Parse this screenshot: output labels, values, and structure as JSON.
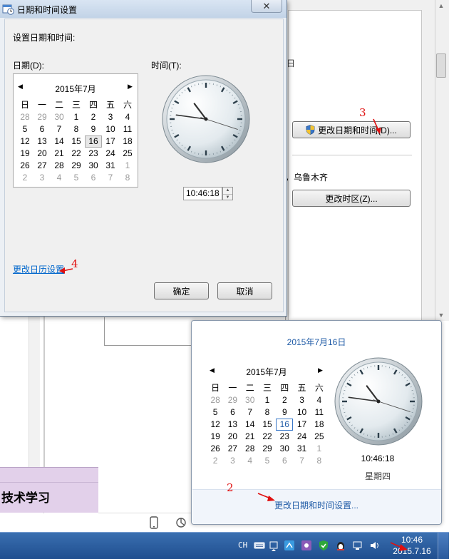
{
  "dialog": {
    "title": "日期和时间设置",
    "heading": "设置日期和时间:",
    "date_label": "日期(D):",
    "time_label": "时间(T):",
    "calendar": {
      "month_title": "2015年7月",
      "weekdays": [
        "日",
        "一",
        "二",
        "三",
        "四",
        "五",
        "六"
      ],
      "weeks": [
        [
          [
            "28",
            1
          ],
          [
            "29",
            1
          ],
          [
            "30",
            1
          ],
          [
            "1",
            0
          ],
          [
            "2",
            0
          ],
          [
            "3",
            0
          ],
          [
            "4",
            0
          ]
        ],
        [
          [
            "5",
            0
          ],
          [
            "6",
            0
          ],
          [
            "7",
            0
          ],
          [
            "8",
            0
          ],
          [
            "9",
            0
          ],
          [
            "10",
            0
          ],
          [
            "11",
            0
          ]
        ],
        [
          [
            "12",
            0
          ],
          [
            "13",
            0
          ],
          [
            "14",
            0
          ],
          [
            "15",
            0
          ],
          [
            "16",
            2
          ],
          [
            "17",
            0
          ],
          [
            "18",
            0
          ]
        ],
        [
          [
            "19",
            0
          ],
          [
            "20",
            0
          ],
          [
            "21",
            0
          ],
          [
            "22",
            0
          ],
          [
            "23",
            0
          ],
          [
            "24",
            0
          ],
          [
            "25",
            0
          ]
        ],
        [
          [
            "26",
            0
          ],
          [
            "27",
            0
          ],
          [
            "28",
            0
          ],
          [
            "29",
            0
          ],
          [
            "30",
            0
          ],
          [
            "31",
            0
          ],
          [
            "1",
            1
          ]
        ],
        [
          [
            "2",
            1
          ],
          [
            "3",
            1
          ],
          [
            "4",
            1
          ],
          [
            "5",
            1
          ],
          [
            "6",
            1
          ],
          [
            "7",
            1
          ],
          [
            "8",
            1
          ]
        ]
      ]
    },
    "time_value": "10:46:18",
    "change_calendar_link": "更改日历设置",
    "ok_label": "确定",
    "cancel_label": "取消",
    "close_glyph": "✕"
  },
  "background": {
    "change_datetime_button": "更改日期和时间(D)...",
    "timezone_text": "，乌鲁木齐",
    "change_timezone_button": "更改时区(Z)...",
    "stray_char": "日",
    "left_label": "技术学习"
  },
  "popup": {
    "date_heading": "2015年7月16日",
    "calendar": {
      "month_title": "2015年7月",
      "weekdays": [
        "日",
        "一",
        "二",
        "三",
        "四",
        "五",
        "六"
      ],
      "weeks": [
        [
          [
            "28",
            1
          ],
          [
            "29",
            1
          ],
          [
            "30",
            1
          ],
          [
            "1",
            0
          ],
          [
            "2",
            0
          ],
          [
            "3",
            0
          ],
          [
            "4",
            0
          ]
        ],
        [
          [
            "5",
            0
          ],
          [
            "6",
            0
          ],
          [
            "7",
            0
          ],
          [
            "8",
            0
          ],
          [
            "9",
            0
          ],
          [
            "10",
            0
          ],
          [
            "11",
            0
          ]
        ],
        [
          [
            "12",
            0
          ],
          [
            "13",
            0
          ],
          [
            "14",
            0
          ],
          [
            "15",
            0
          ],
          [
            "16",
            3
          ],
          [
            "17",
            0
          ],
          [
            "18",
            0
          ]
        ],
        [
          [
            "19",
            0
          ],
          [
            "20",
            0
          ],
          [
            "21",
            0
          ],
          [
            "22",
            0
          ],
          [
            "23",
            0
          ],
          [
            "24",
            0
          ],
          [
            "25",
            0
          ]
        ],
        [
          [
            "26",
            0
          ],
          [
            "27",
            0
          ],
          [
            "28",
            0
          ],
          [
            "29",
            0
          ],
          [
            "30",
            0
          ],
          [
            "31",
            0
          ],
          [
            "1",
            1
          ]
        ],
        [
          [
            "2",
            1
          ],
          [
            "3",
            1
          ],
          [
            "4",
            1
          ],
          [
            "5",
            1
          ],
          [
            "6",
            1
          ],
          [
            "7",
            1
          ],
          [
            "8",
            1
          ]
        ]
      ]
    },
    "time": "10:46:18",
    "weekday": "星期四",
    "change_link": "更改日期和时间设置..."
  },
  "clock": {
    "hours": 10,
    "minutes": 46,
    "seconds": 18
  },
  "annotations": {
    "step2": "2",
    "step3": "3",
    "step4": "4",
    "color": "#e01010"
  },
  "taskbar": {
    "language": "CH",
    "tray_time": "10:46",
    "tray_date": "2015.7.16",
    "colors": {
      "bar": "#2a5c9e"
    }
  }
}
